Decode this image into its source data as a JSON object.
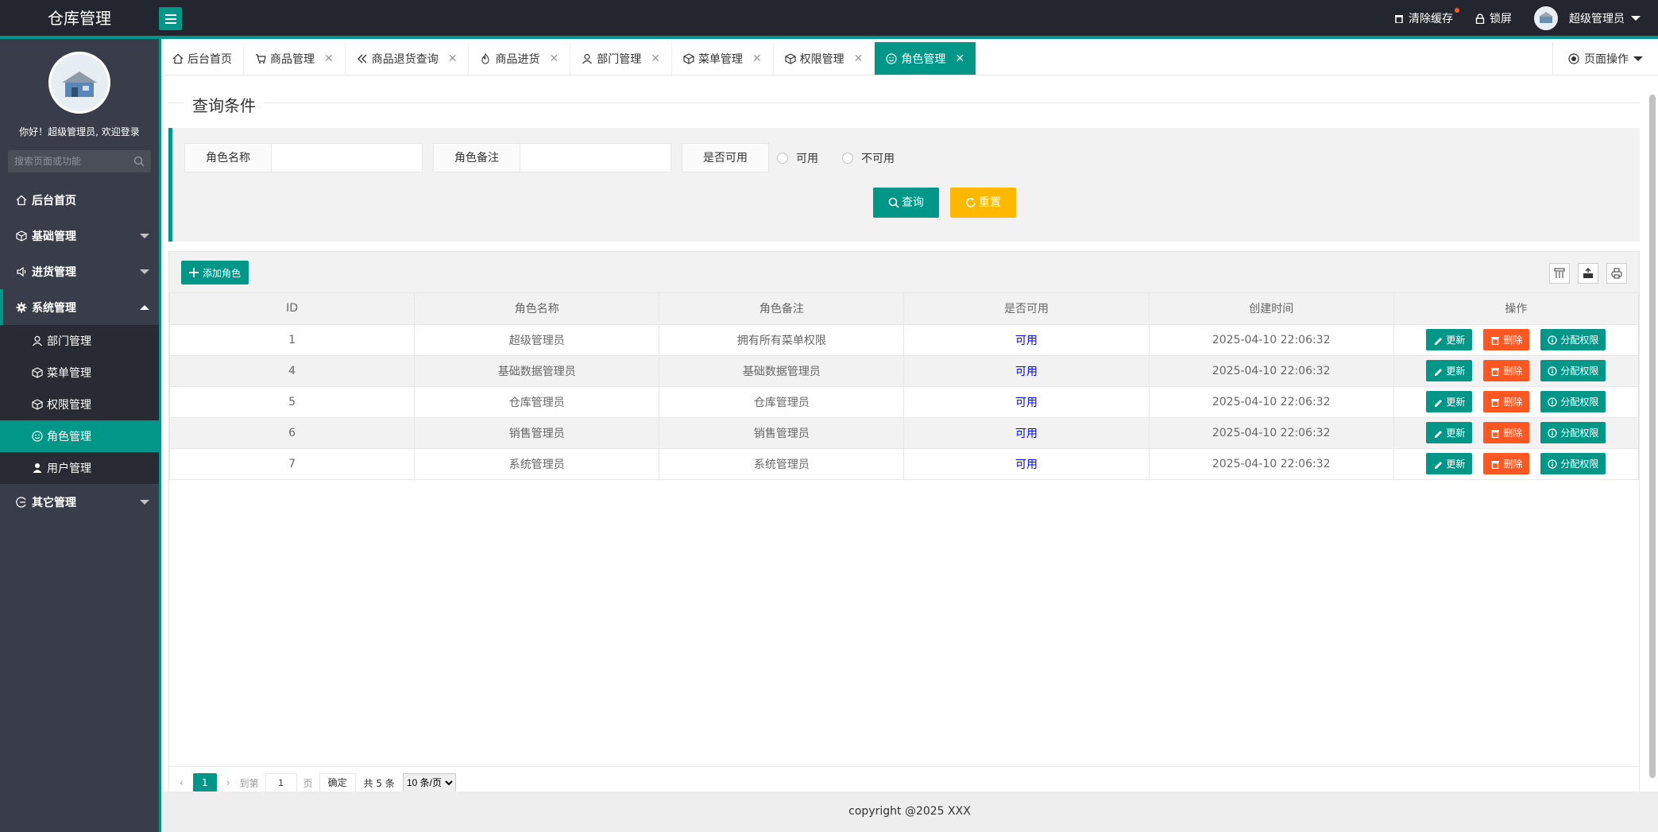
{
  "app": {
    "title": "仓库管理"
  },
  "header": {
    "clear_cache": "清除缓存",
    "lock": "锁屏",
    "user": "超级管理员"
  },
  "sidebar": {
    "welcome": "你好！超级管理员, 欢迎登录",
    "search_placeholder": "搜索页面或功能",
    "items": [
      {
        "label": "后台首页"
      },
      {
        "label": "基础管理"
      },
      {
        "label": "进货管理"
      },
      {
        "label": "系统管理"
      },
      {
        "label": "其它管理"
      }
    ],
    "sub_items": [
      {
        "label": "部门管理"
      },
      {
        "label": "菜单管理"
      },
      {
        "label": "权限管理"
      },
      {
        "label": "角色管理"
      },
      {
        "label": "用户管理"
      }
    ]
  },
  "tabs": [
    {
      "label": "后台首页"
    },
    {
      "label": "商品管理"
    },
    {
      "label": "商品退货查询"
    },
    {
      "label": "商品进货"
    },
    {
      "label": "部门管理"
    },
    {
      "label": "菜单管理"
    },
    {
      "label": "权限管理"
    },
    {
      "label": "角色管理"
    }
  ],
  "page_ops": "页面操作",
  "query": {
    "title": "查询条件",
    "role_name_label": "角色名称",
    "role_remark_label": "角色备注",
    "available_label": "是否可用",
    "opt_available": "可用",
    "opt_unavailable": "不可用",
    "search_btn": "查询",
    "reset_btn": "重置"
  },
  "table": {
    "add_btn": "添加角色",
    "columns": [
      "ID",
      "角色名称",
      "角色备注",
      "是否可用",
      "创建时间",
      "操作"
    ],
    "rows": [
      {
        "id": "1",
        "name": "超级管理员",
        "remark": "拥有所有菜单权限",
        "available": "可用",
        "created": "2025-04-10 22:06:32"
      },
      {
        "id": "4",
        "name": "基础数据管理员",
        "remark": "基础数据管理员",
        "available": "可用",
        "created": "2025-04-10 22:06:32"
      },
      {
        "id": "5",
        "name": "仓库管理员",
        "remark": "仓库管理员",
        "available": "可用",
        "created": "2025-04-10 22:06:32"
      },
      {
        "id": "6",
        "name": "销售管理员",
        "remark": "销售管理员",
        "available": "可用",
        "created": "2025-04-10 22:06:32"
      },
      {
        "id": "7",
        "name": "系统管理员",
        "remark": "系统管理员",
        "available": "可用",
        "created": "2025-04-10 22:06:32"
      }
    ],
    "row_actions": {
      "update": "更新",
      "delete": "删除",
      "assign": "分配权限"
    }
  },
  "pager": {
    "current": "1",
    "goto": "到第",
    "page_value": "1",
    "page": "页",
    "confirm": "确定",
    "total": "共 5 条",
    "per_page": "10 条/页"
  },
  "footer": "copyright @2025 XXX"
}
